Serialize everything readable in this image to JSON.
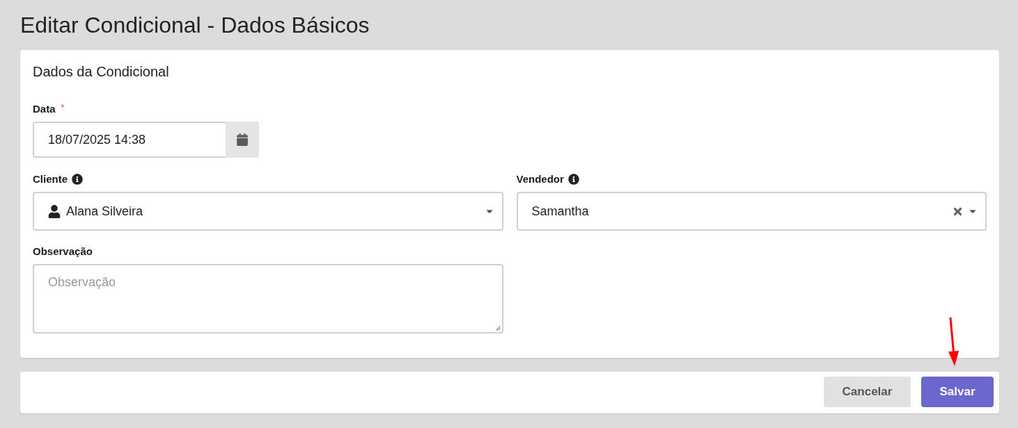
{
  "page": {
    "title": "Editar Condicional - Dados Básicos"
  },
  "form": {
    "title": "Dados da Condicional",
    "date": {
      "label": "Data",
      "required_mark": "*",
      "value": "18/07/2025 14:38"
    },
    "client": {
      "label": "Cliente",
      "info": true,
      "value": "Alana Silveira"
    },
    "seller": {
      "label": "Vendedor",
      "info": true,
      "value": "Samantha",
      "clearable": true
    },
    "note": {
      "label": "Observação",
      "placeholder": "Observação"
    }
  },
  "actions": [
    {
      "label": "Cancelar",
      "kind": "secondary"
    },
    {
      "label": "Salvar",
      "kind": "primary"
    }
  ]
}
